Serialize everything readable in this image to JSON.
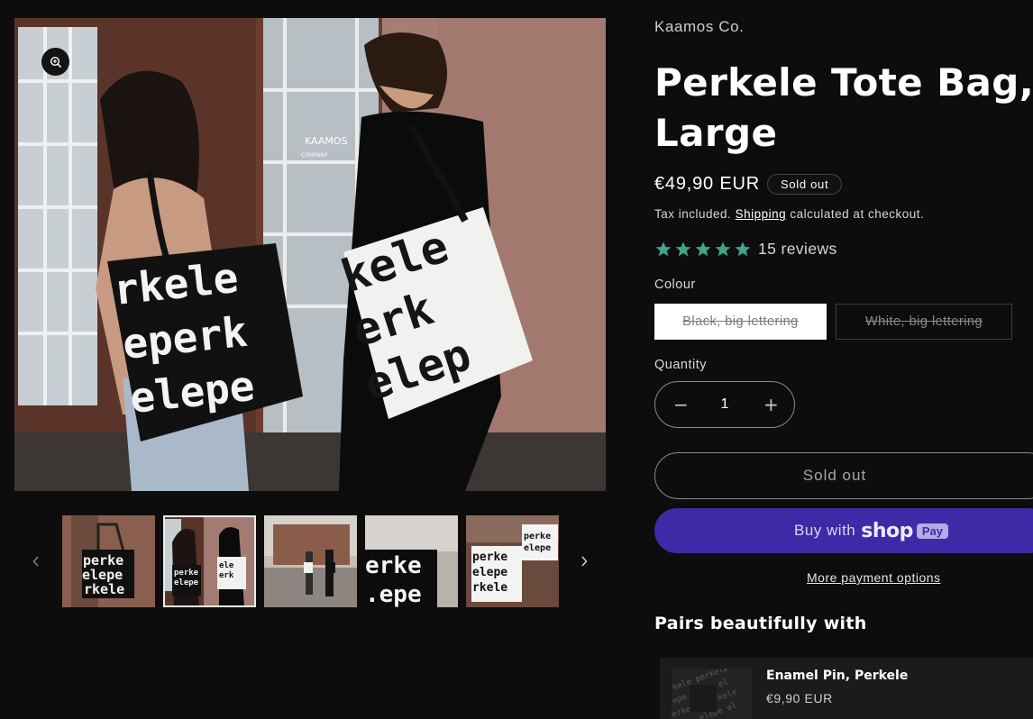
{
  "gallery": {
    "main_image": "Two people carrying black and white Perkele tote bags in front of the Kaamos shop door",
    "zoom_icon": "zoom-in-icon",
    "thumbnails": [
      "thumb-1",
      "thumb-2",
      "thumb-3",
      "thumb-4",
      "thumb-5"
    ],
    "active_thumbnail": 2,
    "bag_text_black": [
      "rkele",
      "eperk",
      "elepe"
    ],
    "bag_text_white": [
      "kele",
      "erk",
      "elep"
    ],
    "sign_text": [
      "KAAMOS",
      "COMPANY"
    ]
  },
  "product": {
    "vendor": "Kaamos Co.",
    "title": "Perkele Tote Bag, Large",
    "price": "€49,90 EUR",
    "badge": "Sold out",
    "tax_note_before": "Tax included.",
    "tax_note_link": "Shipping",
    "tax_note_after": "calculated at checkout.",
    "rating": 5,
    "reviews": "15 reviews",
    "star_color": "#3fa58a",
    "colour_label": "Colour",
    "colour_options": [
      "Black, big lettering",
      "White, big lettering"
    ],
    "selected_colour": "Black, big lettering",
    "quantity_label": "Quantity",
    "quantity": "1",
    "minus": "−",
    "plus": "+",
    "sold_out_button": "Sold out",
    "shop_pay": {
      "prefix": "Buy with",
      "brand": "shop",
      "pay": "Pay"
    },
    "shop_pay_color": "#3c2aa6",
    "more_payment": "More payment options"
  },
  "pairs": {
    "heading": "Pairs beautifully with",
    "item": {
      "name": "Enamel Pin, Perkele",
      "price": "€9,90 EUR"
    }
  }
}
